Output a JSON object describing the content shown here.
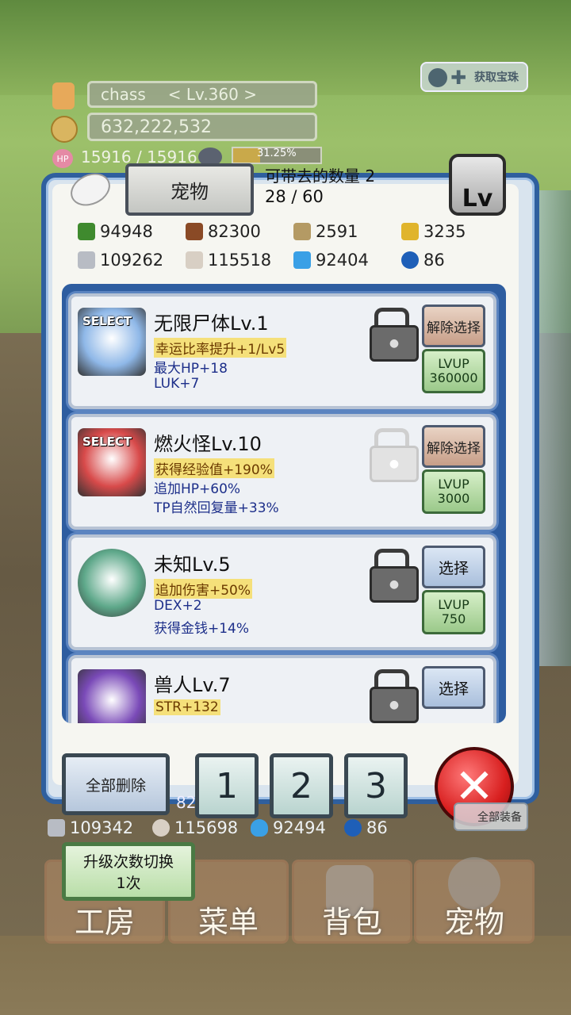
{
  "player": {
    "name": "chass",
    "level": "< Lv.360 >",
    "gold": "632,222,532",
    "hp": "15916 / 15916",
    "exp_percent": "31.25%",
    "exp_fraction": 0.3125
  },
  "top_right_button": {
    "label": "获取宝珠"
  },
  "pet_window": {
    "tab_label": "宠物",
    "carry_label": "可带去的数量 2",
    "count": "28 / 60",
    "lv_badge": "Lv"
  },
  "resources": [
    {
      "icon": "leaf-icon",
      "value": "94948",
      "color": "#3f8a2e"
    },
    {
      "icon": "wood-icon",
      "value": "82300",
      "color": "#8a4a26"
    },
    {
      "icon": "plank-icon",
      "value": "2591",
      "color": "#b49a64"
    },
    {
      "icon": "drop-icon",
      "value": "3235",
      "color": "#e0b42c"
    },
    {
      "icon": "iron-icon",
      "value": "109262",
      "color": "#b8bcc4"
    },
    {
      "icon": "stone-icon",
      "value": "115518",
      "color": "#d8cfc4"
    },
    {
      "icon": "flame-icon",
      "value": "92404",
      "color": "#3aa0e6"
    },
    {
      "icon": "orb-icon",
      "value": "86",
      "color": "#1e5fb8"
    }
  ],
  "pets": [
    {
      "name": "无限尸体Lv.1",
      "selected": true,
      "select_tag": "SELECT",
      "stats": [
        {
          "text": "幸运比率提升+1/Lv5",
          "kind": "y"
        },
        {
          "text": "最大HP+18",
          "kind": "b"
        },
        {
          "text": "LUK+7",
          "kind": "b"
        }
      ],
      "locked": true,
      "select_label": "解除选择",
      "lvup_label": "LVUP",
      "lvup_cost": "360000",
      "cost_icon": "flame-icon",
      "color": "#8fb8e8"
    },
    {
      "name": "燃火怪Lv.10",
      "selected": true,
      "select_tag": "SELECT",
      "stats": [
        {
          "text": "获得经验值+190%",
          "kind": "y"
        },
        {
          "text": "追加HP+60%",
          "kind": "b"
        },
        {
          "text": "TP自然回复量+33%",
          "kind": "b"
        }
      ],
      "locked": false,
      "select_label": "解除选择",
      "lvup_label": "LVUP",
      "lvup_cost": "3000",
      "cost_icon": "drop-icon",
      "color": "#d84a4a"
    },
    {
      "name": "未知Lv.5",
      "selected": false,
      "select_tag": "",
      "stats": [
        {
          "text": "追加伤害+50%",
          "kind": "y"
        },
        {
          "text": "DEX+2",
          "kind": "b"
        },
        {
          "text": "获得金钱+14%",
          "kind": "b"
        }
      ],
      "locked": true,
      "select_label": "选择",
      "lvup_label": "LVUP",
      "lvup_cost": "750",
      "cost_icon": "drop-icon",
      "color": "#5ea88a"
    },
    {
      "name": "兽人Lv.7",
      "selected": false,
      "select_tag": "",
      "stats": [
        {
          "text": "STR+132",
          "kind": "y"
        }
      ],
      "locked": true,
      "select_label": "选择",
      "lvup_label": "",
      "lvup_cost": "",
      "cost_icon": "",
      "color": "#7a4ab8"
    }
  ],
  "window_footer": {
    "delete_all": "全部删除",
    "slot1": "1",
    "slot2": "2",
    "slot3": "3"
  },
  "bottom_resources": [
    {
      "icon": "iron-icon",
      "value": "109342"
    },
    {
      "icon": "stone-icon",
      "value": "115698"
    },
    {
      "icon": "flame-icon",
      "value": "92494"
    },
    {
      "icon": "orb-icon",
      "value": "86"
    }
  ],
  "partial_hidden": {
    "equip_all": "全部装备",
    "res_peek": "82"
  },
  "toggle_button": {
    "line1": "升级次数切换",
    "line2": "1次"
  },
  "bottom_nav": [
    "工房",
    "菜单",
    "背包",
    "宠物"
  ]
}
